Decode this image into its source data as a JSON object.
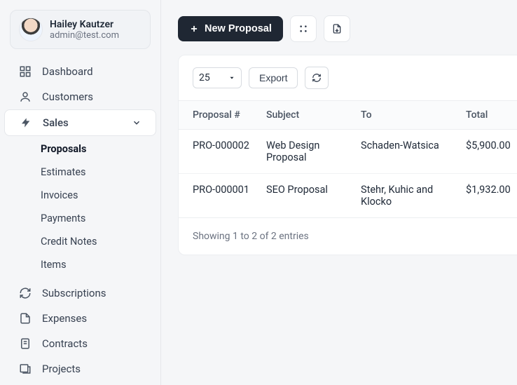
{
  "user": {
    "name": "Hailey Kautzer",
    "email": "admin@test.com"
  },
  "sidebar": {
    "items": [
      {
        "label": "Dashboard"
      },
      {
        "label": "Customers"
      },
      {
        "label": "Sales"
      },
      {
        "label": "Subscriptions"
      },
      {
        "label": "Expenses"
      },
      {
        "label": "Contracts"
      },
      {
        "label": "Projects"
      }
    ],
    "sales_sub": [
      {
        "label": "Proposals"
      },
      {
        "label": "Estimates"
      },
      {
        "label": "Invoices"
      },
      {
        "label": "Payments"
      },
      {
        "label": "Credit Notes"
      },
      {
        "label": "Items"
      }
    ]
  },
  "toolbar": {
    "new_proposal_label": "New Proposal"
  },
  "table": {
    "page_size": "25",
    "export_label": "Export",
    "headers": {
      "proposal": "Proposal #",
      "subject": "Subject",
      "to": "To",
      "total": "Total"
    },
    "rows": [
      {
        "proposal": "PRO-000002",
        "subject": "Web Design Proposal",
        "to": "Schaden-Watsica",
        "total": "$5,900.00"
      },
      {
        "proposal": "PRO-000001",
        "subject": "SEO Proposal",
        "to": "Stehr, Kuhic and Klocko",
        "total": "$1,932.00"
      }
    ],
    "footer": "Showing 1 to 2 of 2 entries"
  }
}
